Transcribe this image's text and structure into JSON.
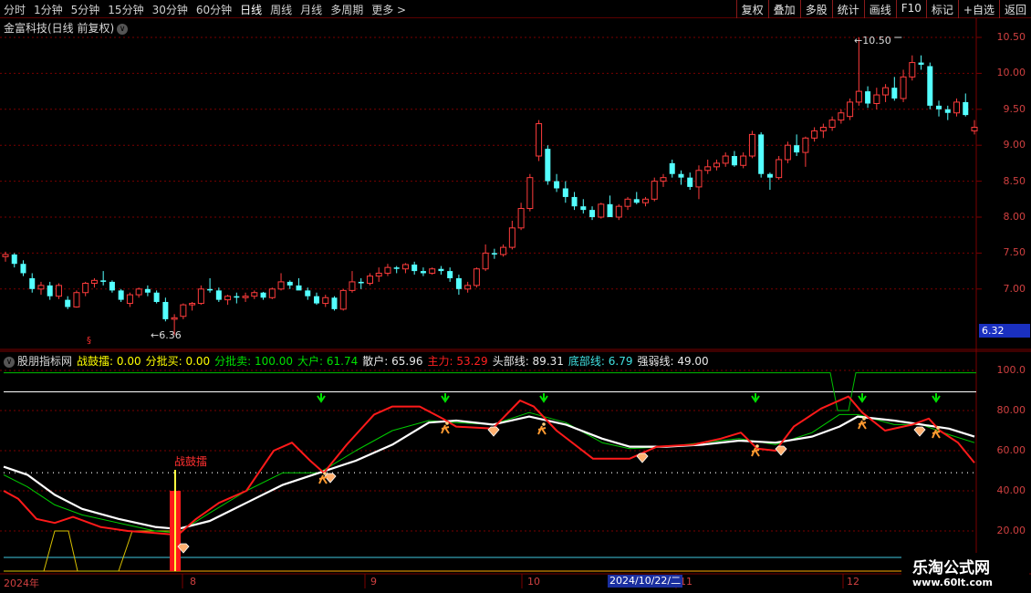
{
  "toolbar": {
    "periods": [
      "分时",
      "1分钟",
      "5分钟",
      "15分钟",
      "30分钟",
      "60分钟",
      "日线",
      "周线",
      "月线",
      "多周期",
      "更多 >"
    ],
    "active_period": "日线",
    "actions": [
      "复权",
      "叠加",
      "多股",
      "统计",
      "画线",
      "F10",
      "标记",
      "+自选",
      "返回"
    ]
  },
  "stock": {
    "title": "金富科技(日线 前复权)",
    "high_label": "10.50",
    "low_label": "6.36",
    "last_price": "6.32",
    "price_axis": [
      "10.50",
      "10.00",
      "9.50",
      "9.00",
      "8.50",
      "8.00",
      "7.50",
      "7.00"
    ]
  },
  "indicator": {
    "name": "股朋指标网",
    "items": [
      {
        "label": "战鼓擂: 0.00",
        "color": "#ffff00"
      },
      {
        "label": "分批买: 0.00",
        "color": "#ffff00"
      },
      {
        "label": "分批卖: 100.00",
        "color": "#00e000"
      },
      {
        "label": "大户: 61.74",
        "color": "#00e000"
      },
      {
        "label": "散户: 65.96",
        "color": "#e8e8e8"
      },
      {
        "label": "主力: 53.29",
        "color": "#ff2020"
      },
      {
        "label": "头部线: 89.31",
        "color": "#e8e8e8"
      },
      {
        "label": "底部线: 6.79",
        "color": "#40e0e0"
      },
      {
        "label": "强弱线: 49.00",
        "color": "#e8e8e8"
      }
    ],
    "axis": [
      "100.0",
      "80.00",
      "60.00",
      "40.00",
      "20.00"
    ],
    "signal_label": "战鼓擂"
  },
  "dates": {
    "year": "2024年",
    "months": [
      "8",
      "9",
      "10",
      "11",
      "12"
    ],
    "cursor": "2024/10/22/二"
  },
  "watermark": {
    "line1": "乐淘公式网",
    "line2": "www.60lt.com"
  },
  "colors": {
    "up": "#ff3c3c",
    "down": "#54ffff",
    "grid": "#7a0000",
    "main": "#ff1a1a",
    "retail": "#ffffff",
    "big": "#00cc00"
  },
  "chart_data": {
    "type": "candlestick",
    "price_range": [
      6.2,
      10.8
    ],
    "candles": [
      [
        7.45,
        7.52,
        7.38,
        7.48
      ],
      [
        7.48,
        7.5,
        7.3,
        7.35
      ],
      [
        7.35,
        7.4,
        7.18,
        7.22
      ],
      [
        7.15,
        7.22,
        6.95,
        7.0
      ],
      [
        7.0,
        7.1,
        6.92,
        7.05
      ],
      [
        7.05,
        7.1,
        6.85,
        6.9
      ],
      [
        6.9,
        7.08,
        6.86,
        7.05
      ],
      [
        6.85,
        6.9,
        6.72,
        6.75
      ],
      [
        6.75,
        6.98,
        6.74,
        6.95
      ],
      [
        6.95,
        7.1,
        6.9,
        7.08
      ],
      [
        7.08,
        7.15,
        7.02,
        7.12
      ],
      [
        7.12,
        7.25,
        7.05,
        7.1
      ],
      [
        7.1,
        7.12,
        6.95,
        6.98
      ],
      [
        6.98,
        7.0,
        6.82,
        6.85
      ],
      [
        6.8,
        6.95,
        6.75,
        6.92
      ],
      [
        6.92,
        7.02,
        6.88,
        7.0
      ],
      [
        7.0,
        7.05,
        6.9,
        6.95
      ],
      [
        6.95,
        6.98,
        6.8,
        6.82
      ],
      [
        6.82,
        6.88,
        6.55,
        6.58
      ],
      [
        6.58,
        6.65,
        6.36,
        6.6
      ],
      [
        6.62,
        6.8,
        6.58,
        6.78
      ],
      [
        6.78,
        6.82,
        6.7,
        6.8
      ],
      [
        6.8,
        7.05,
        6.78,
        7.0
      ],
      [
        7.0,
        7.15,
        6.95,
        6.98
      ],
      [
        6.98,
        7.02,
        6.82,
        6.85
      ],
      [
        6.85,
        6.92,
        6.78,
        6.9
      ],
      [
        6.9,
        6.95,
        6.8,
        6.88
      ],
      [
        6.88,
        6.95,
        6.82,
        6.9
      ],
      [
        6.9,
        6.98,
        6.86,
        6.95
      ],
      [
        6.95,
        6.96,
        6.85,
        6.88
      ],
      [
        6.88,
        7.02,
        6.86,
        7.0
      ],
      [
        7.0,
        7.22,
        6.98,
        7.1
      ],
      [
        7.1,
        7.12,
        7.0,
        7.05
      ],
      [
        7.05,
        7.15,
        7.0,
        6.98
      ],
      [
        6.98,
        7.02,
        6.85,
        6.9
      ],
      [
        6.9,
        6.95,
        6.78,
        6.8
      ],
      [
        6.8,
        6.92,
        6.75,
        6.88
      ],
      [
        6.88,
        6.9,
        6.7,
        6.72
      ],
      [
        6.72,
        7.0,
        6.7,
        6.98
      ],
      [
        6.98,
        7.25,
        6.95,
        7.1
      ],
      [
        7.1,
        7.15,
        7.0,
        7.08
      ],
      [
        7.08,
        7.22,
        7.05,
        7.18
      ],
      [
        7.18,
        7.3,
        7.1,
        7.22
      ],
      [
        7.22,
        7.35,
        7.18,
        7.3
      ],
      [
        7.3,
        7.32,
        7.22,
        7.28
      ],
      [
        7.28,
        7.36,
        7.22,
        7.34
      ],
      [
        7.34,
        7.38,
        7.2,
        7.25
      ],
      [
        7.25,
        7.3,
        7.18,
        7.22
      ],
      [
        7.22,
        7.3,
        7.2,
        7.28
      ],
      [
        7.28,
        7.32,
        7.2,
        7.25
      ],
      [
        7.25,
        7.3,
        7.1,
        7.15
      ],
      [
        7.15,
        7.2,
        6.92,
        7.0
      ],
      [
        7.0,
        7.1,
        6.95,
        7.05
      ],
      [
        7.05,
        7.3,
        7.02,
        7.28
      ],
      [
        7.28,
        7.62,
        7.25,
        7.5
      ],
      [
        7.5,
        7.56,
        7.42,
        7.48
      ],
      [
        7.48,
        7.62,
        7.45,
        7.58
      ],
      [
        7.58,
        7.95,
        7.55,
        7.85
      ],
      [
        7.85,
        8.2,
        7.82,
        8.12
      ],
      [
        8.12,
        8.6,
        8.08,
        8.55
      ],
      [
        8.85,
        9.35,
        8.78,
        9.3
      ],
      [
        8.95,
        9.0,
        8.45,
        8.5
      ],
      [
        8.5,
        8.6,
        8.35,
        8.4
      ],
      [
        8.4,
        8.5,
        8.2,
        8.28
      ],
      [
        8.28,
        8.35,
        8.1,
        8.15
      ],
      [
        8.15,
        8.25,
        8.05,
        8.1
      ],
      [
        8.1,
        8.15,
        7.96,
        8.0
      ],
      [
        8.0,
        8.2,
        7.98,
        8.18
      ],
      [
        8.18,
        8.3,
        8.05,
        8.0
      ],
      [
        8.0,
        8.18,
        7.96,
        8.15
      ],
      [
        8.15,
        8.28,
        8.1,
        8.25
      ],
      [
        8.25,
        8.35,
        8.18,
        8.2
      ],
      [
        8.2,
        8.28,
        8.15,
        8.25
      ],
      [
        8.25,
        8.55,
        8.22,
        8.5
      ],
      [
        8.5,
        8.6,
        8.42,
        8.55
      ],
      [
        8.75,
        8.8,
        8.55,
        8.6
      ],
      [
        8.6,
        8.65,
        8.45,
        8.55
      ],
      [
        8.55,
        8.62,
        8.38,
        8.42
      ],
      [
        8.42,
        8.72,
        8.25,
        8.65
      ],
      [
        8.65,
        8.8,
        8.6,
        8.7
      ],
      [
        8.7,
        8.8,
        8.65,
        8.75
      ],
      [
        8.75,
        8.9,
        8.7,
        8.85
      ],
      [
        8.85,
        8.92,
        8.7,
        8.72
      ],
      [
        8.72,
        8.9,
        8.68,
        8.85
      ],
      [
        8.85,
        9.2,
        8.82,
        9.15
      ],
      [
        9.15,
        9.18,
        8.55,
        8.6
      ],
      [
        8.6,
        8.62,
        8.38,
        8.55
      ],
      [
        8.55,
        8.85,
        8.52,
        8.8
      ],
      [
        8.8,
        9.05,
        8.75,
        9.0
      ],
      [
        9.0,
        9.15,
        8.85,
        8.9
      ],
      [
        8.9,
        9.12,
        8.7,
        9.1
      ],
      [
        9.1,
        9.25,
        9.05,
        9.2
      ],
      [
        9.2,
        9.3,
        9.1,
        9.25
      ],
      [
        9.25,
        9.4,
        9.2,
        9.35
      ],
      [
        9.35,
        9.5,
        9.3,
        9.45
      ],
      [
        9.4,
        9.65,
        9.35,
        9.6
      ],
      [
        9.6,
        10.5,
        9.55,
        9.75
      ],
      [
        9.75,
        9.82,
        9.52,
        9.58
      ],
      [
        9.58,
        9.8,
        9.5,
        9.7
      ],
      [
        9.7,
        9.85,
        9.6,
        9.8
      ],
      [
        9.8,
        9.95,
        9.62,
        9.65
      ],
      [
        9.65,
        10.05,
        9.6,
        9.95
      ],
      [
        9.95,
        10.25,
        9.9,
        10.15
      ],
      [
        10.15,
        10.25,
        10.05,
        10.12
      ],
      [
        10.1,
        10.15,
        9.5,
        9.55
      ],
      [
        9.55,
        9.62,
        9.4,
        9.5
      ],
      [
        9.5,
        9.55,
        9.35,
        9.45
      ],
      [
        9.45,
        9.65,
        9.4,
        9.6
      ],
      [
        9.6,
        9.72,
        9.4,
        9.42
      ],
      [
        9.2,
        9.35,
        9.15,
        9.25
      ]
    ],
    "indicator_range": [
      10,
      105
    ],
    "signal_bar_index": 22,
    "signal_bar_value": 40,
    "head_line": 89.31,
    "strength_line": 49,
    "bottom_line": 6.79
  }
}
